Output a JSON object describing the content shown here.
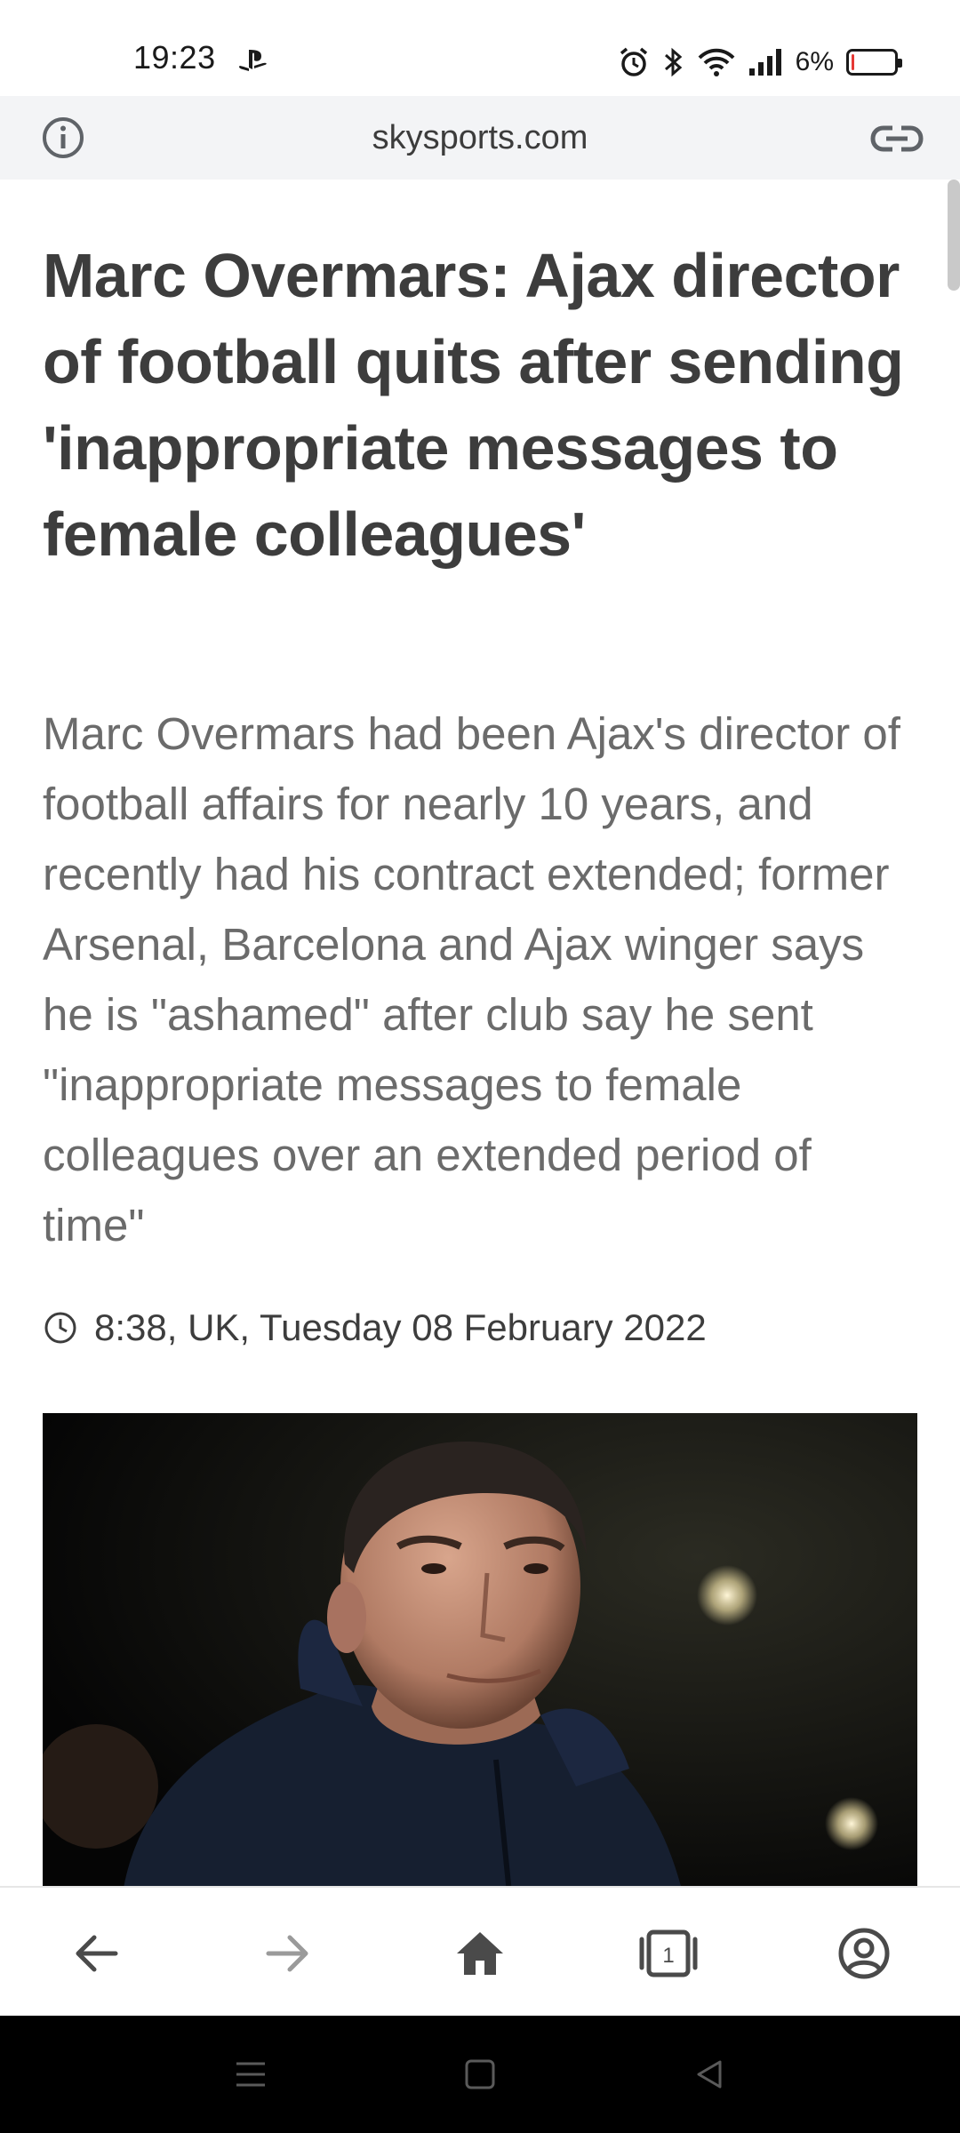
{
  "status_bar": {
    "time": "19:23",
    "battery_percent": "6%",
    "battery_level": 0.06,
    "icons": [
      "playstation-icon",
      "alarm-icon",
      "bluetooth-icon",
      "wifi-icon",
      "signal-icon",
      "battery-icon"
    ]
  },
  "url_bar": {
    "url": "skysports.com",
    "left_icon": "info-icon",
    "right_icon": "link-icon"
  },
  "article": {
    "headline": "Marc Overmars: Ajax director of football quits after sending 'inappropriate messages to female colleagues'",
    "standfirst": "Marc Overmars had been Ajax's director of football affairs for nearly 10 years, and recently had his contract extended; former Arsenal, Barcelona and Ajax winger says he is \"ashamed\" after club say he sent \"inappropriate messages to female colleagues over an extended period of time\"",
    "timestamp": "8:38, UK, Tuesday 08 February 2022",
    "image_subject": "photo of Marc Overmars"
  },
  "toolbar": {
    "buttons": [
      "back-icon",
      "forward-icon",
      "home-icon",
      "tabs-icon",
      "account-icon"
    ],
    "tab_count": "1"
  },
  "system_nav": {
    "buttons": [
      "menu-icon",
      "home-square-icon",
      "back-triangle-icon"
    ]
  },
  "colors": {
    "headline": "#3d3d3d",
    "standfirst": "#6b6b6b",
    "url_bar_bg": "#f3f4f6",
    "battery_low": "#e53935"
  }
}
